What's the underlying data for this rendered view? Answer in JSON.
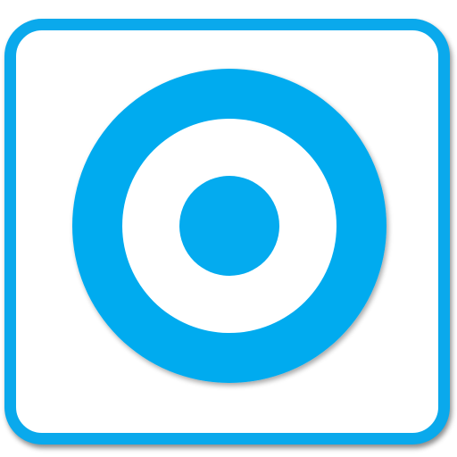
{
  "icon": {
    "name": "target-icon",
    "frame_color": "#0aa9ec",
    "ring_color": "#04abef",
    "background_color": "#ffffff"
  }
}
